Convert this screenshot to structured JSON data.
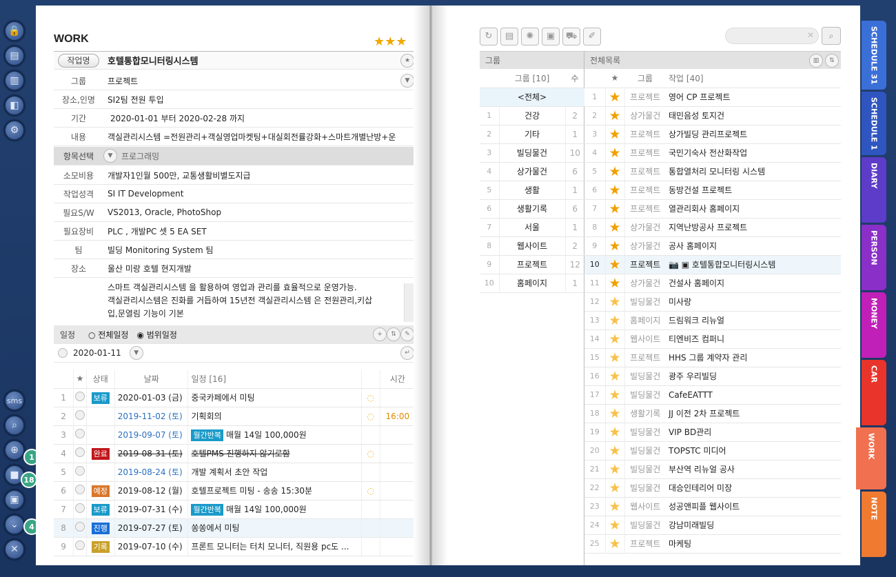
{
  "work": {
    "title": "WORK",
    "stars": "★★★",
    "name_label": "작업명",
    "name": "호텔통합모니터링시스템",
    "fields": [
      {
        "label": "그룹",
        "value": "프로젝트"
      },
      {
        "label": "장소,인명",
        "value": "SI2팀 전원 투입"
      },
      {
        "label": "기간",
        "value": "2020-01-01  부터  2020-02-28  까지"
      },
      {
        "label": "내용",
        "value": "객실관리시스템 =전원관리+객실영업마켓팅+대실회전률강화+스마트개별난방+운"
      }
    ],
    "item_select_label": "항목선택",
    "item_select_value": "프로그래밍",
    "items": [
      {
        "label": "소모비용",
        "value": "개발자1인월 500만, 교통생활비별도지급"
      },
      {
        "label": "작업성격",
        "value": "SI IT Development"
      },
      {
        "label": "필요S/W",
        "value": "VS2013, Oracle, PhotoShop"
      },
      {
        "label": "필요장비",
        "value": "PLC , 개발PC 셋 5 EA SET"
      },
      {
        "label": "팀",
        "value": "빌딩 Monitoring System 팀"
      },
      {
        "label": "장소",
        "value": "울산 미랑 호텔 현지개발"
      }
    ],
    "memo": "스마트 객실관리시스템 을 활용하여 영업과 관리를 효율적으로 운영가능.\n객실관리시스템은 진화를 거듭하여 15년전 객실관리시스템 은 전원관리,키삽\n입,문열림 기능이 기본"
  },
  "schedule": {
    "label": "일정",
    "opt_all": "전체일정",
    "opt_range": "범위일정",
    "date": "2020-01-11",
    "headers": {
      "star": "★",
      "status": "상태",
      "date": "날짜",
      "title": "일정 [16]",
      "time": "시간"
    },
    "rows": [
      {
        "n": "1",
        "status": "보류",
        "color": "#1a9ac9",
        "date": "2020-01-03 (금)",
        "title": "중국카페에서 미팅",
        "time": "",
        "datecolor": "#222"
      },
      {
        "n": "2",
        "status": "",
        "color": "",
        "date": "2019-11-02 (토)",
        "title": "기획회의",
        "time": "16:00",
        "datecolor": "#2a6fc0"
      },
      {
        "n": "3",
        "status": "",
        "color": "",
        "date": "2019-09-07 (토)",
        "title": "매월 14일 100,000원",
        "tag": "월간반복",
        "time": "",
        "datecolor": "#2a6fc0"
      },
      {
        "n": "4",
        "status": "완료",
        "color": "#c0161b",
        "date": "2019-08-31 (토)",
        "title": "호텔PMS 진행하지 않기로함",
        "time": "",
        "datecolor": "#222",
        "strike": true
      },
      {
        "n": "5",
        "status": "",
        "color": "",
        "date": "2019-08-24 (토)",
        "title": "개발 계획서 초안 작업",
        "time": "",
        "datecolor": "#2a6fc0"
      },
      {
        "n": "6",
        "status": "예정",
        "color": "#d9762a",
        "date": "2019-08-12 (월)",
        "title": "호텔프로젝트 미팅 - 송송 15:30분",
        "time": "",
        "datecolor": "#222"
      },
      {
        "n": "7",
        "status": "보류",
        "color": "#1a9ac9",
        "date": "2019-07-31 (수)",
        "title": "매월 14일 100,000원",
        "tag": "월간반복",
        "time": "",
        "datecolor": "#222"
      },
      {
        "n": "8",
        "status": "진행",
        "color": "#1a6fd6",
        "date": "2019-07-27 (토)",
        "title": "쏭쏭에서 미팅",
        "time": "",
        "datecolor": "#222"
      },
      {
        "n": "9",
        "status": "기록",
        "color": "#c9a02a",
        "date": "2019-07-10 (수)",
        "title": "프론트 모니터는 터치 모니터, 직원용 pc도 ...",
        "time": "",
        "datecolor": "#222"
      }
    ]
  },
  "left_badges": [
    "1",
    "18",
    "4"
  ],
  "sms": "sms",
  "group_panel": {
    "title": "그룹",
    "col_group": "그룹 [10]",
    "col_count": "수",
    "all": "<전체>",
    "rows": [
      [
        "1",
        "건강",
        "2"
      ],
      [
        "2",
        "기타",
        "1"
      ],
      [
        "3",
        "빌딩물건",
        "10"
      ],
      [
        "4",
        "상가물건",
        "6"
      ],
      [
        "5",
        "생활",
        "1"
      ],
      [
        "6",
        "생활기록",
        "6"
      ],
      [
        "7",
        "서울",
        "1"
      ],
      [
        "8",
        "웹사이트",
        "2"
      ],
      [
        "9",
        "프로젝트",
        "12"
      ],
      [
        "10",
        "홈페이지",
        "1"
      ]
    ]
  },
  "list_panel": {
    "title": "전체목록",
    "col_star": "★",
    "col_group": "그룹",
    "col_work": "작업 [40]",
    "rows": [
      [
        "1",
        "3",
        "프로젝트",
        "영어 CP 프로젝트"
      ],
      [
        "2",
        "3",
        "상가물건",
        "태민음성 토지건"
      ],
      [
        "3",
        "3",
        "프로젝트",
        "상가빌딩 관리프로젝트"
      ],
      [
        "4",
        "3",
        "프로젝트",
        "국민기숙사 전산화작업"
      ],
      [
        "5",
        "3",
        "프로젝트",
        "통합열처리 모니터링 시스템"
      ],
      [
        "6",
        "3",
        "프로젝트",
        "동방건설 프로젝트"
      ],
      [
        "7",
        "3",
        "프로젝트",
        "열관리회사 홈페이지"
      ],
      [
        "8",
        "3",
        "상가물건",
        "지역난방공사 프로젝트"
      ],
      [
        "9",
        "3",
        "상가물건",
        "공사 홈페이지"
      ],
      [
        "10",
        "3",
        "프로젝트",
        "호텔통합모니터링시스템"
      ],
      [
        "11",
        "3",
        "상가물건",
        "건설사 홈페이지"
      ],
      [
        "12",
        "1",
        "빌딩물건",
        "미사랑"
      ],
      [
        "13",
        "1",
        "홈페이지",
        "드림워크 리뉴얼"
      ],
      [
        "14",
        "1",
        "웹사이트",
        "티엔비즈 컴퍼니"
      ],
      [
        "15",
        "1",
        "프로젝트",
        "HHS 그룹 계약자 관리"
      ],
      [
        "16",
        "1",
        "빌딩물건",
        "광주 우리빌딩"
      ],
      [
        "17",
        "1",
        "빌딩물건",
        "CafeEATTT"
      ],
      [
        "18",
        "1",
        "생활기록",
        "JJ 이전 2차 프로젝트"
      ],
      [
        "19",
        "1",
        "빌딩물건",
        "VIP BD관리"
      ],
      [
        "20",
        "1",
        "빌딩물건",
        "TOPSTC 미디어"
      ],
      [
        "21",
        "1",
        "빌딩물건",
        "부산역 리뉴얼 공사"
      ],
      [
        "22",
        "1",
        "빌딩물건",
        "대승인테리어 미장"
      ],
      [
        "23",
        "1",
        "웹사이트",
        "성공앤피플 웹사이트"
      ],
      [
        "24",
        "1",
        "빌딩물건",
        "강남미래빌딩"
      ],
      [
        "25",
        "1",
        "프로젝트",
        "마케팅"
      ]
    ]
  },
  "tabs": [
    {
      "label": "SCHEDULE 31",
      "color": "#3b6fd8"
    },
    {
      "label": "SCHEDULE 1",
      "color": "#2f55c0"
    },
    {
      "label": "DIARY",
      "color": "#5c3cc8"
    },
    {
      "label": "PERSON",
      "color": "#8a2fc8"
    },
    {
      "label": "MONEY",
      "color": "#c020b8"
    },
    {
      "label": "CAR",
      "color": "#e8342a"
    },
    {
      "label": "WORK",
      "color": "#f07050"
    },
    {
      "label": "NOTE",
      "color": "#f07a30"
    }
  ]
}
